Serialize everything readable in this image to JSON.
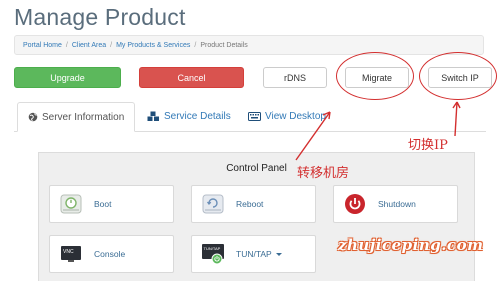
{
  "page": {
    "title": "Manage Product"
  },
  "breadcrumb": {
    "items": [
      "Portal Home",
      "Client Area",
      "My Products & Services"
    ],
    "current": "Product Details",
    "separator": "/"
  },
  "actions": {
    "upgrade": "Upgrade",
    "cancel": "Cancel",
    "rdns": "rDNS",
    "migrate": "Migrate",
    "switch_ip": "Switch IP"
  },
  "tabs": [
    {
      "label": "Server Information",
      "icon": "globe-icon",
      "active": true
    },
    {
      "label": "Service Details",
      "icon": "cubes-icon",
      "active": false
    },
    {
      "label": "View Desktop",
      "icon": "keyboard-icon",
      "active": false
    }
  ],
  "control_panel": {
    "title": "Control Panel",
    "tiles": [
      {
        "label": "Boot",
        "icon": "power-drive-icon"
      },
      {
        "label": "Reboot",
        "icon": "reboot-drive-icon"
      },
      {
        "label": "Shutdown",
        "icon": "power-off-icon"
      },
      {
        "label": "Console",
        "icon": "vnc-icon",
        "icon_text": "VNC"
      },
      {
        "label": "TUN/TAP",
        "icon": "tuntap-icon",
        "icon_text": "TUN/TAP"
      }
    ]
  },
  "annotations": {
    "switch_ip_note": "切换IP",
    "migrate_note": "转移机房",
    "watermark": "zhujiceping.com"
  },
  "colors": {
    "success": "#5cb85c",
    "danger": "#d9534f",
    "link": "#337ab7",
    "annotation": "#d32f2f"
  }
}
